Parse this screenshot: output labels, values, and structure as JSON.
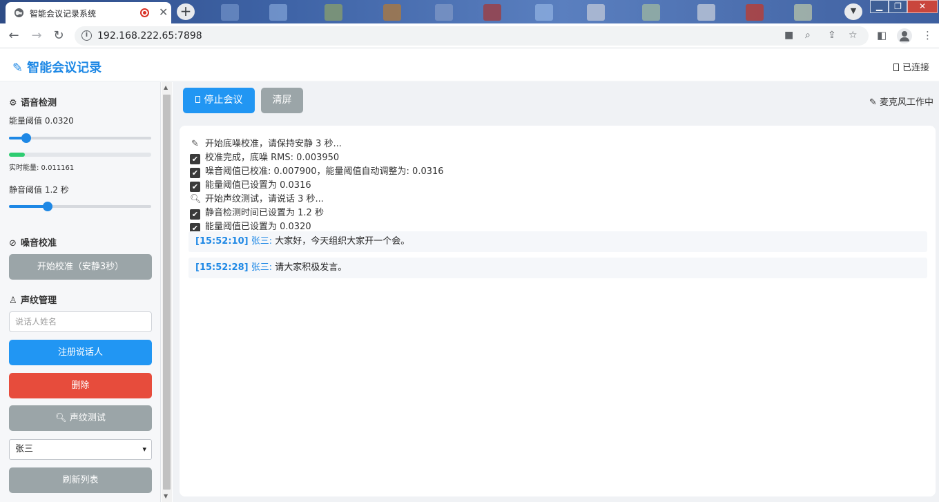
{
  "browser": {
    "tab_title": "智能会议记录系统",
    "tab_close": "✕",
    "new_tab": "+",
    "url": "192.168.222.65:7898",
    "win_min": "▁",
    "win_max": "❐",
    "win_close": "✕"
  },
  "header": {
    "brand": "智能会议记录",
    "connection": "已连接"
  },
  "sidebar": {
    "voice_detect": {
      "title": "语音检测",
      "energy_label": "能量阈值 0.0320",
      "energy_level": 0.12,
      "realtime_label": "实时能量: 0.011161",
      "realtime_level": 0.11,
      "silence_label": "静音阈值 1.2 秒",
      "silence_level": 0.27
    },
    "noise": {
      "title": "噪音校准",
      "calibrate_button": "开始校准（安静3秒）"
    },
    "voiceprint": {
      "title": "声纹管理",
      "name_placeholder": "说话人姓名",
      "register_button": "注册说话人",
      "delete_button": "删除",
      "test_button": "声纹测试",
      "selected_speaker": "张三",
      "refresh_button": "刷新列表"
    }
  },
  "main": {
    "stop_button": "停止会议",
    "clear_button": "清屏",
    "mic_status": "麦克风工作中",
    "log": [
      {
        "icon": "pencil",
        "text": "开始底噪校准，请保持安静 3 秒..."
      },
      {
        "icon": "check",
        "text": "校准完成，底噪 RMS: 0.003950"
      },
      {
        "icon": "check",
        "text": "噪音阈值已校准: 0.007900，能量阈值自动调整为: 0.0316"
      },
      {
        "icon": "check",
        "text": "能量阈值已设置为 0.0316"
      },
      {
        "icon": "search",
        "text": "开始声纹测试，请说话 3 秒..."
      },
      {
        "icon": "check",
        "text": "静音检测时间已设置为 1.2 秒"
      },
      {
        "icon": "check",
        "text": "能量阈值已设置为 0.0320"
      }
    ],
    "messages": [
      {
        "time": "[15:52:10]",
        "speaker": "张三:",
        "text": "大家好，今天组织大家开一个会。"
      },
      {
        "time": "[15:52:28]",
        "speaker": "张三:",
        "text": "请大家积极发言。"
      }
    ]
  }
}
